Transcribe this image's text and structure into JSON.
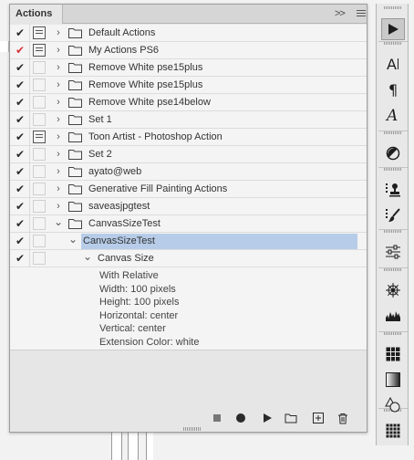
{
  "panel": {
    "tab_label": "Actions",
    "collapse_glyph": ">>"
  },
  "rows": [
    {
      "check": "✔",
      "check_color": "#2b2b2b",
      "dialog": true,
      "indent": 0,
      "expanded": false,
      "folder": true,
      "name": "Default Actions"
    },
    {
      "check": "✔",
      "check_color": "#d9333f",
      "dialog": true,
      "indent": 0,
      "expanded": false,
      "folder": true,
      "name": "My Actions PS6"
    },
    {
      "check": "✔",
      "check_color": "#2b2b2b",
      "dialog": false,
      "indent": 0,
      "expanded": false,
      "folder": true,
      "name": "Remove White pse15plus"
    },
    {
      "check": "✔",
      "check_color": "#2b2b2b",
      "dialog": false,
      "indent": 0,
      "expanded": false,
      "folder": true,
      "name": "Remove White pse15plus"
    },
    {
      "check": "✔",
      "check_color": "#2b2b2b",
      "dialog": false,
      "indent": 0,
      "expanded": false,
      "folder": true,
      "name": "Remove White pse14below"
    },
    {
      "check": "✔",
      "check_color": "#2b2b2b",
      "dialog": false,
      "indent": 0,
      "expanded": false,
      "folder": true,
      "name": "Set 1"
    },
    {
      "check": "✔",
      "check_color": "#2b2b2b",
      "dialog": true,
      "indent": 0,
      "expanded": false,
      "folder": true,
      "name": "Toon Artist - Photoshop Action"
    },
    {
      "check": "✔",
      "check_color": "#2b2b2b",
      "dialog": false,
      "indent": 0,
      "expanded": false,
      "folder": true,
      "name": "Set 2"
    },
    {
      "check": "✔",
      "check_color": "#2b2b2b",
      "dialog": false,
      "indent": 0,
      "expanded": false,
      "folder": true,
      "name": "ayato@web"
    },
    {
      "check": "✔",
      "check_color": "#2b2b2b",
      "dialog": false,
      "indent": 0,
      "expanded": false,
      "folder": true,
      "name": "Generative Fill Painting Actions"
    },
    {
      "check": "✔",
      "check_color": "#2b2b2b",
      "dialog": false,
      "indent": 0,
      "expanded": false,
      "folder": true,
      "name": "saveasjpgtest"
    },
    {
      "check": "✔",
      "check_color": "#2b2b2b",
      "dialog": false,
      "indent": 0,
      "expanded": true,
      "folder": true,
      "name": "CanvasSizeTest"
    },
    {
      "check": "✔",
      "check_color": "#2b2b2b",
      "dialog": false,
      "indent": 1,
      "expanded": true,
      "folder": false,
      "name": "CanvasSizeTest",
      "selected": true
    },
    {
      "check": "✔",
      "check_color": "#2b2b2b",
      "dialog": false,
      "indent": 2,
      "expanded": true,
      "folder": false,
      "name": "Canvas Size"
    }
  ],
  "step_details": [
    "With Relative",
    "Width: 100 pixels",
    "Height: 100 pixels",
    "Horizontal: center",
    "Vertical: center",
    "Extension Color: white"
  ],
  "footer_buttons": [
    {
      "name": "stop-button",
      "icon": "stop-icon"
    },
    {
      "name": "record-button",
      "icon": "record-icon"
    },
    {
      "name": "play-button",
      "icon": "play-icon"
    },
    {
      "name": "new-set-button",
      "icon": "folder-icon"
    },
    {
      "name": "new-action-button",
      "icon": "plus-square-icon"
    },
    {
      "name": "delete-button",
      "icon": "trash-icon"
    }
  ],
  "tools": [
    {
      "name": "actions-tool",
      "icon": "play-icon",
      "active": true
    },
    {
      "name": "character-tool",
      "icon": "type-icon"
    },
    {
      "name": "paragraph-tool",
      "icon": "pilcrow-icon"
    },
    {
      "name": "glyphs-tool",
      "icon": "script-a-icon"
    },
    {
      "name": "adjustments-tool",
      "icon": "half-circle-icon"
    },
    {
      "name": "clone-source-tool",
      "icon": "stamp-icon"
    },
    {
      "name": "brush-settings-tool",
      "icon": "brush-icon"
    },
    {
      "name": "properties-tool",
      "icon": "sliders-icon"
    },
    {
      "name": "navigator-tool",
      "icon": "compass-icon"
    },
    {
      "name": "histogram-tool",
      "icon": "histogram-icon"
    },
    {
      "name": "swatches-tool",
      "icon": "grid-icon"
    },
    {
      "name": "gradients-tool",
      "icon": "gradient-icon"
    },
    {
      "name": "shapes-tool",
      "icon": "shapes-icon"
    },
    {
      "name": "patterns-tool",
      "icon": "pattern-icon"
    }
  ],
  "colors": {
    "selection": "#b6cce8",
    "check_red": "#d9333f",
    "panel_bg": "#e6e6e6"
  }
}
